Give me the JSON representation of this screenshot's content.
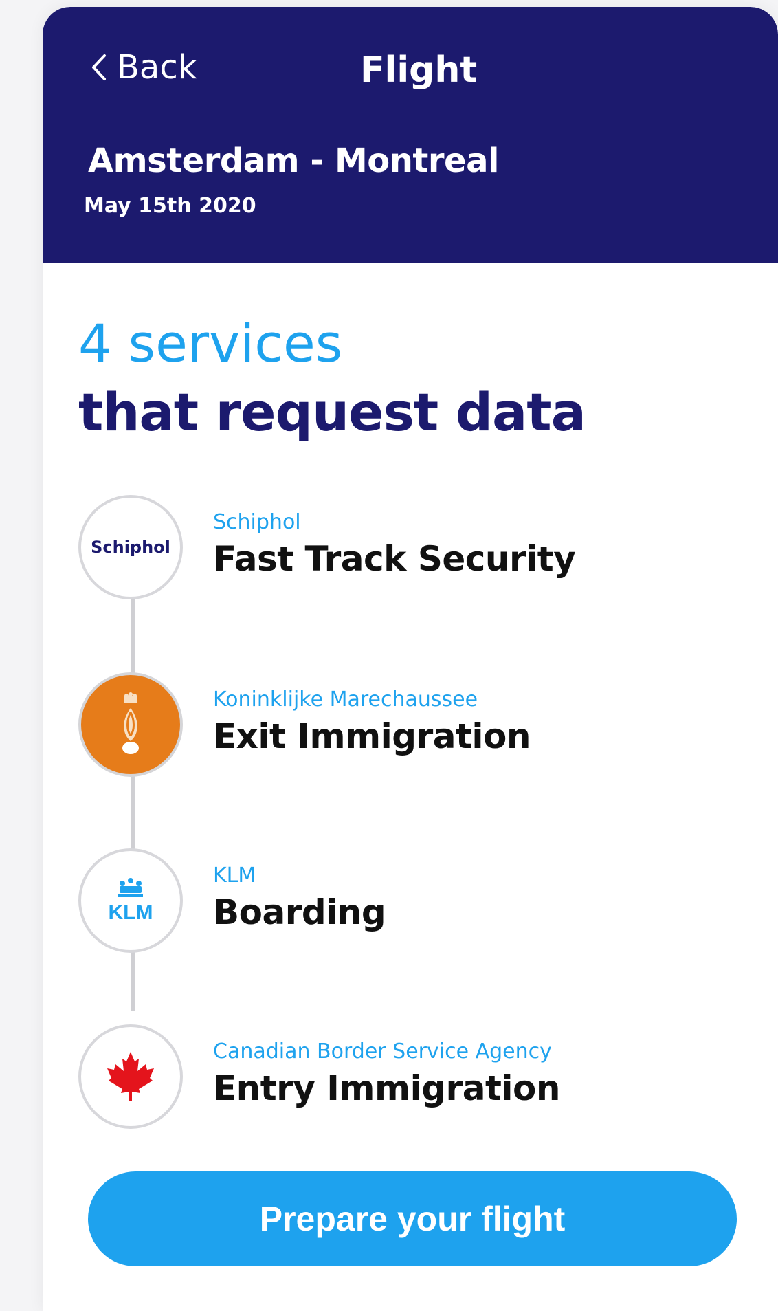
{
  "header": {
    "back_label": "Back",
    "title": "Flight",
    "route": "Amsterdam - Montreal",
    "date": "May 15th 2020"
  },
  "headline": {
    "count": "4 services",
    "subtitle": "that request data"
  },
  "services": [
    {
      "org": "Schiphol",
      "name": "Fast Track Security",
      "logo": "schiphol-logo",
      "logo_text": "Schiphol"
    },
    {
      "org": "Koninklijke Marechaussee",
      "name": "Exit Immigration",
      "logo": "marechaussee-emblem"
    },
    {
      "org": "KLM",
      "name": "Boarding",
      "logo": "klm-logo",
      "logo_text": "KLM"
    },
    {
      "org": "Canadian Border Service Agency",
      "name": "Entry Immigration",
      "logo": "maple-leaf-icon"
    }
  ],
  "cta": {
    "label": "Prepare your flight"
  },
  "colors": {
    "header_bg": "#1c1a6e",
    "accent": "#1ea2ee",
    "marechaussee_orange": "#e67c1a",
    "maple_red": "#e4141c"
  }
}
